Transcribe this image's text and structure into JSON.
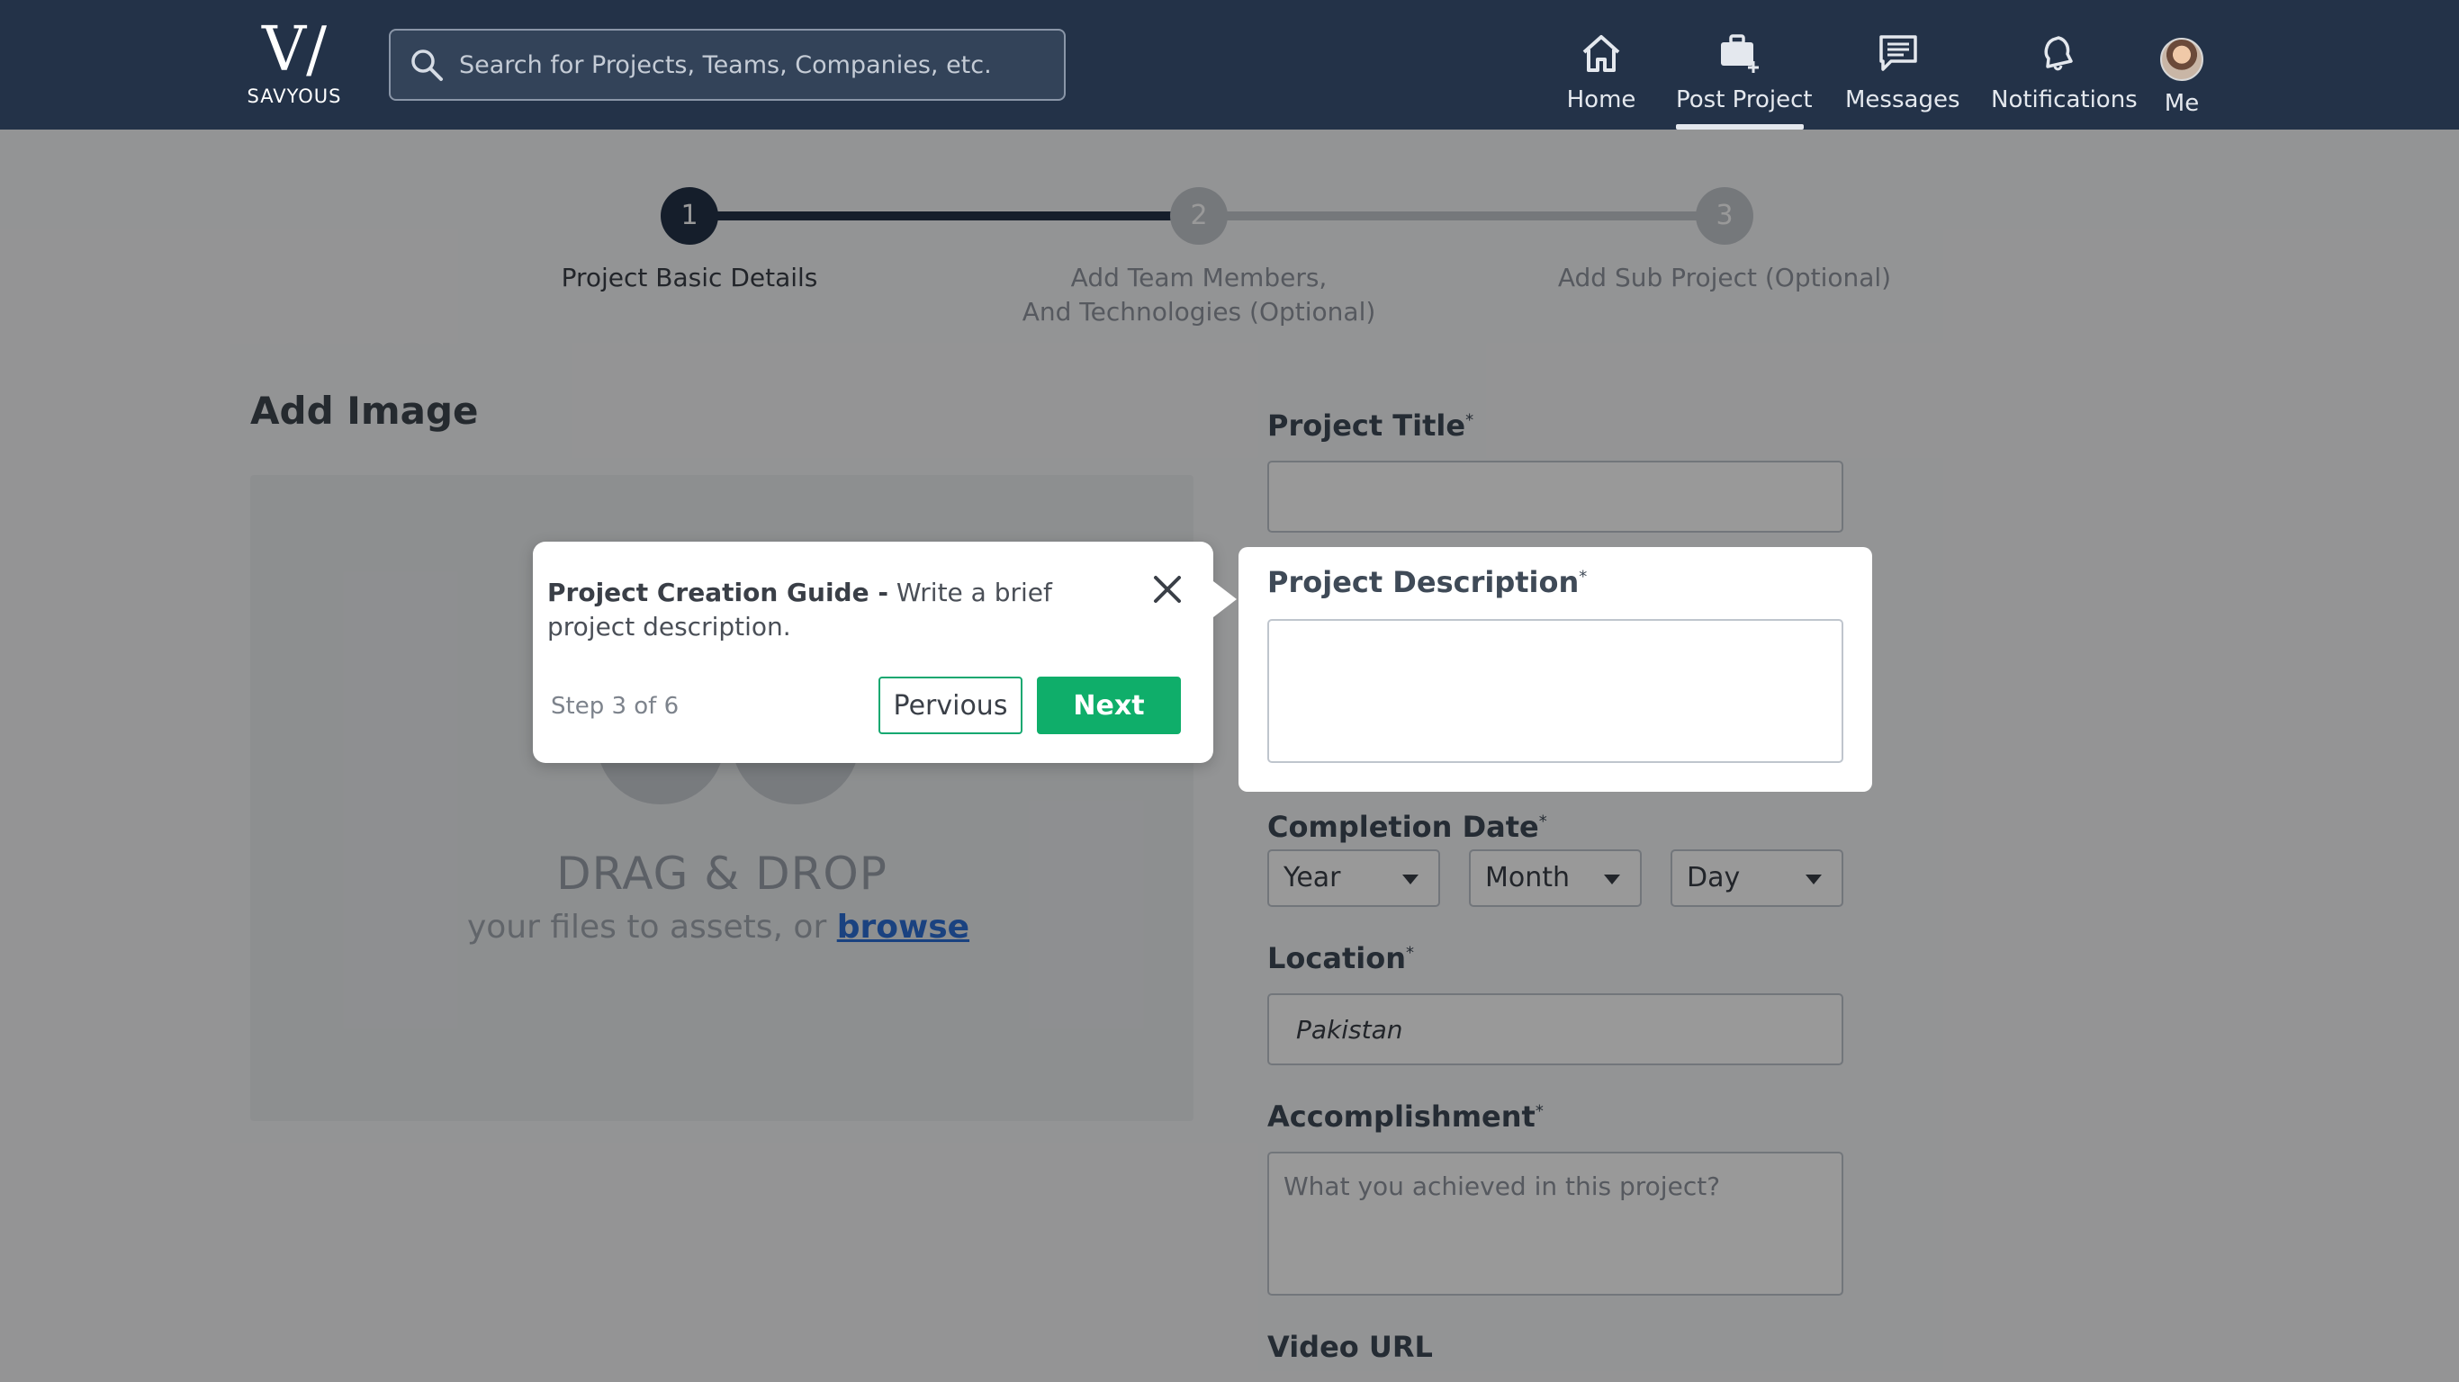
{
  "brand": {
    "logo_mark": "V/",
    "logo_text": "SAVYOUS"
  },
  "search": {
    "placeholder": "Search for Projects, Teams, Companies, etc."
  },
  "nav": {
    "home": "Home",
    "post_project": "Post Project",
    "messages": "Messages",
    "notifications": "Notifications",
    "me": "Me"
  },
  "stepper": {
    "steps": [
      {
        "number": "1",
        "label_line1": "Project Basic Details",
        "label_line2": "",
        "state": "active"
      },
      {
        "number": "2",
        "label_line1": "Add Team Members,",
        "label_line2": "And Technologies (Optional)",
        "state": "inactive"
      },
      {
        "number": "3",
        "label_line1": "Add Sub Project (Optional)",
        "label_line2": "",
        "state": "inactive"
      }
    ]
  },
  "image_section": {
    "title": "Add Image",
    "drag_title": "DRAG & DROP",
    "drag_sub": "your files to assets, or",
    "browse": "browse"
  },
  "form": {
    "project_title": {
      "label": "Project Title",
      "required": "*",
      "value": ""
    },
    "project_description": {
      "label": "Project Description",
      "required": "*",
      "value": ""
    },
    "completion_date": {
      "label": "Completion Date",
      "required": "*",
      "year": "Year",
      "month": "Month",
      "day": "Day"
    },
    "location": {
      "label": "Location",
      "required": "*",
      "value": "Pakistan"
    },
    "accomplishment": {
      "label": "Accomplishment",
      "required": "*",
      "placeholder": "What you achieved in this project?"
    },
    "video_url": {
      "label": "Video URL"
    }
  },
  "tour": {
    "title": "Project Creation Guide -",
    "text": "Write a brief project description.",
    "step": "Step 3 of 6",
    "prev": "Pervious",
    "next": "Next"
  },
  "colors": {
    "nav_bg": "#233248",
    "accent_green": "#0fae6a",
    "step_active": "#233248",
    "step_inactive": "#c4c8ce",
    "link_blue": "#2c6fd6"
  }
}
